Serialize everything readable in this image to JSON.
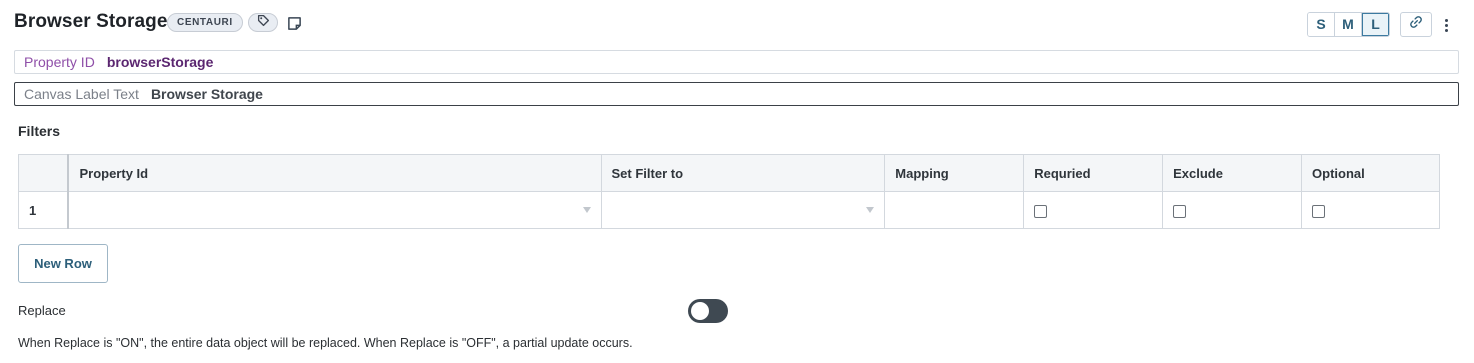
{
  "header": {
    "title": "Browser Storage",
    "badge": "CENTAURI",
    "size_buttons": [
      "S",
      "M",
      "L"
    ],
    "active_size": "L",
    "icons": {
      "tag": "tag-icon",
      "note": "note-icon",
      "link": "link-icon",
      "more": "more-vertical-icon"
    }
  },
  "properties": {
    "property_id": {
      "label": "Property ID",
      "value": "browserStorage"
    },
    "canvas_label": {
      "label": "Canvas Label Text",
      "value": "Browser Storage"
    }
  },
  "filters": {
    "title": "Filters",
    "columns": [
      "Property Id",
      "Set Filter to",
      "Mapping",
      "Requried",
      "Exclude",
      "Optional"
    ],
    "rows": [
      {
        "num": "1",
        "property_id": "",
        "set_filter_to": "",
        "mapping": "",
        "required": false,
        "exclude": false,
        "optional": false
      }
    ],
    "new_row_label": "New Row"
  },
  "replace": {
    "label": "Replace",
    "enabled": false,
    "help": "When Replace is \"ON\", the entire data object will be replaced. When Replace is \"OFF\", a partial update occurs."
  },
  "colors": {
    "accent": "#2d5f7a",
    "property_id_label": "#8f4fa8",
    "property_id_value": "#5b2670",
    "toggle_off": "#3f4952"
  }
}
